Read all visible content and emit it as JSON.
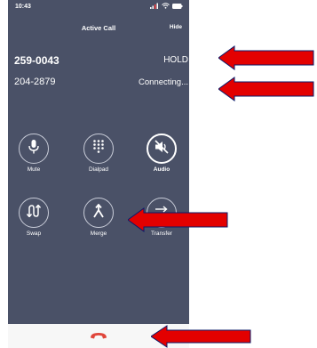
{
  "status_bar": {
    "time": "10:43"
  },
  "header": {
    "title": "Active Call",
    "hide_label": "Hide"
  },
  "calls": [
    {
      "number": "259-0043",
      "status": "HOLD"
    },
    {
      "number": "204-2879",
      "status": "Connecting..."
    }
  ],
  "controls": {
    "mute": {
      "label": "Mute",
      "icon": "microphone-icon"
    },
    "dialpad": {
      "label": "Dialpad",
      "icon": "dialpad-icon"
    },
    "audio": {
      "label": "Audio",
      "icon": "speaker-mute-icon"
    },
    "swap": {
      "label": "Swap",
      "icon": "swap-icon"
    },
    "merge": {
      "label": "Merge",
      "icon": "merge-icon"
    },
    "transfer": {
      "label": "Transfer",
      "icon": "transfer-icon"
    }
  },
  "end_call": {
    "icon": "end-call-icon"
  },
  "colors": {
    "background": "#4a5167",
    "end_call": "#e0463b",
    "annotation_arrow": "#e30000",
    "bottom_bar": "#f7f7f7"
  }
}
